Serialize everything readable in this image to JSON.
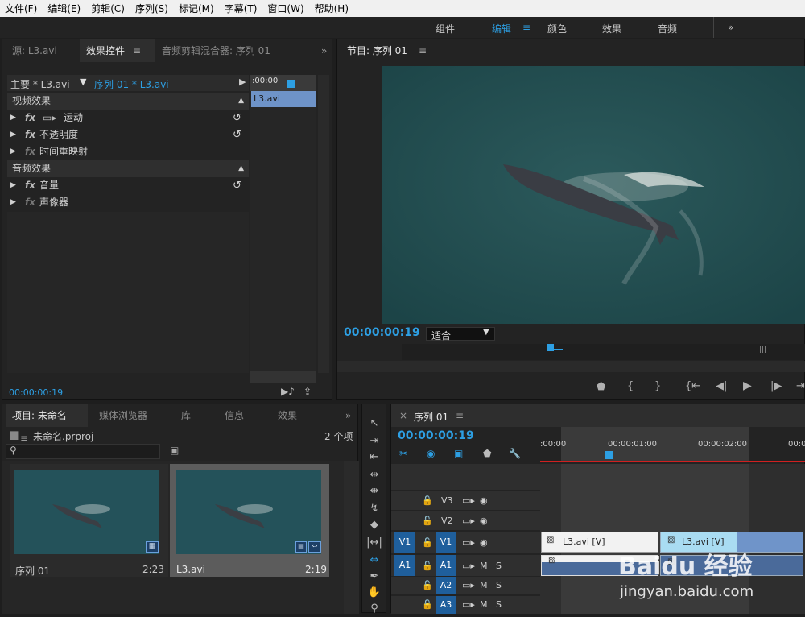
{
  "menu": [
    "文件(F)",
    "编辑(E)",
    "剪辑(C)",
    "序列(S)",
    "标记(M)",
    "字幕(T)",
    "窗口(W)",
    "帮助(H)"
  ],
  "workspaces": {
    "items": [
      "组件",
      "编辑",
      "颜色",
      "效果",
      "音频"
    ],
    "active": "编辑",
    "more": "»"
  },
  "effects_panel": {
    "tabs": [
      "源: L3.avi",
      "效果控件",
      "音频剪辑混合器: 序列 01"
    ],
    "active_tab": "效果控件",
    "more": "»",
    "master_label": "主要 * L3.avi",
    "sequence_label": "序列 01 * L3.avi",
    "ruler_time": ":00:00",
    "clip_name": "L3.avi",
    "video_section": "视频效果",
    "audio_section": "音频效果",
    "effects": [
      {
        "label": "运动",
        "fx": "fx",
        "reset": true
      },
      {
        "label": "不透明度",
        "fx": "fx",
        "reset": true
      },
      {
        "label": "时间重映射",
        "fx": "fx",
        "reset": false
      }
    ],
    "audio_effects": [
      {
        "label": "音量",
        "fx": "fx",
        "reset": true
      },
      {
        "label": "声像器",
        "fx": "fx",
        "reset": false
      }
    ],
    "timecode": "00:00:00:19"
  },
  "program_monitor": {
    "title": "节目: 序列 01",
    "timecode": "00:00:00:19",
    "fit": "适合"
  },
  "project_panel": {
    "tabs": [
      "项目: 未命名",
      "媒体浏览器",
      "库",
      "信息",
      "效果"
    ],
    "active_tab": "项目: 未命名",
    "more": "»",
    "filename": "未命名.prproj",
    "count": "2 个项",
    "items": [
      {
        "name": "序列 01",
        "duration": "2:23"
      },
      {
        "name": "L3.avi",
        "duration": "2:19"
      }
    ]
  },
  "timeline": {
    "title": "序列 01",
    "close": "×",
    "timecode": "00:00:00:19",
    "ruler": [
      ":00:00",
      "00:00:01:00",
      "00:00:02:00",
      "00:0"
    ],
    "video_tracks": [
      "V3",
      "V2",
      "V1"
    ],
    "audio_tracks": [
      "A1",
      "A2",
      "A3"
    ],
    "source_v": "V1",
    "source_a": "A1",
    "mute": "M",
    "solo": "S",
    "clips": [
      {
        "label": "L3.avi [V]"
      },
      {
        "label": "L3.avi [V]"
      }
    ]
  },
  "watermark": {
    "line1": "Baidu 经验",
    "line2": "jingyan.baidu.com"
  }
}
